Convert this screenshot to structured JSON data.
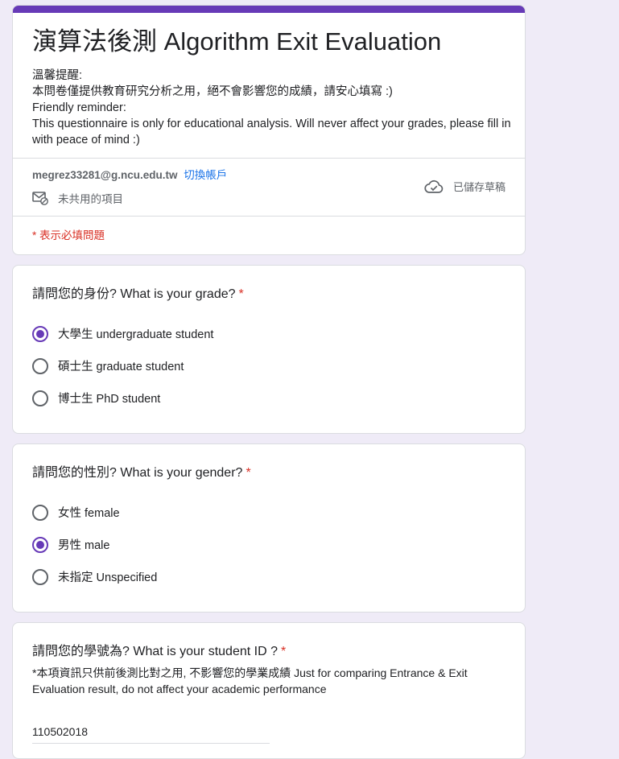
{
  "form": {
    "title": "演算法後測 Algorithm Exit Evaluation",
    "description": [
      "溫馨提醒:",
      "本問卷僅提供教育研究分析之用，絕不會影響您的成績，請安心填寫 :)",
      "Friendly reminder:",
      "This questionnaire is only for educational analysis. Will never affect your grades, please fill in with peace of mind :)"
    ],
    "account_email": "megrez33281@g.ncu.edu.tw",
    "switch_account": "切換帳戶",
    "not_shared": "未共用的項目",
    "saved_draft": "已儲存草稿",
    "required_note": "* 表示必填問題",
    "accent_color": "#673ab7",
    "required_color": "#d93025"
  },
  "questions": {
    "grade": {
      "title": "請問您的身份? What is your grade?",
      "required": "*",
      "options": [
        "大學生 undergraduate student",
        "碩士生 graduate student",
        "博士生 PhD student"
      ],
      "selected": "大學生 undergraduate student"
    },
    "gender": {
      "title": "請問您的性別? What is your gender?",
      "required": "*",
      "options": [
        "女性 female",
        "男性 male",
        "未指定 Unspecified"
      ],
      "selected": "男性 male"
    },
    "student_id": {
      "title": "請問您的學號為? What is your student ID ?",
      "required": "*",
      "help": "*本項資訊只供前後測比對之用, 不影響您的學業成績 Just for comparing Entrance & Exit Evaluation result, do not affect your academic performance",
      "value": "110502018"
    }
  },
  "icons": {
    "not_shared": "mail-block-icon",
    "saved_draft": "cloud-check-icon"
  }
}
